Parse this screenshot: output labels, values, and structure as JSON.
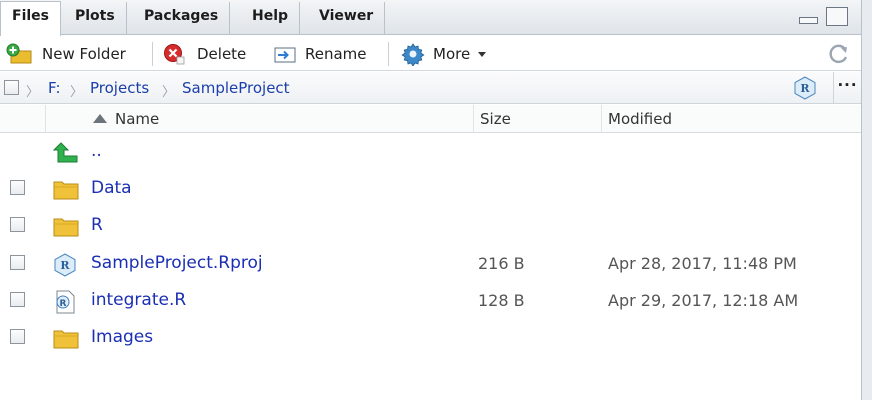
{
  "tabs": [
    {
      "label": "Files"
    },
    {
      "label": "Plots"
    },
    {
      "label": "Packages"
    },
    {
      "label": "Help"
    },
    {
      "label": "Viewer"
    }
  ],
  "toolbar": {
    "new_folder": "New Folder",
    "delete": "Delete",
    "rename": "Rename",
    "more": "More"
  },
  "breadcrumb": {
    "items": [
      "F:",
      "Projects",
      "SampleProject"
    ]
  },
  "table": {
    "columns": {
      "name": "Name",
      "size": "Size",
      "modified": "Modified"
    },
    "rows": [
      {
        "icon": "up-arrow-icon",
        "name": "..",
        "size": "",
        "modified": ""
      },
      {
        "icon": "folder-icon",
        "name": "Data",
        "size": "",
        "modified": ""
      },
      {
        "icon": "folder-icon",
        "name": "R",
        "size": "",
        "modified": ""
      },
      {
        "icon": "rproj-icon",
        "name": "SampleProject.Rproj",
        "size": "216 B",
        "modified": "Apr 28, 2017, 11:48 PM"
      },
      {
        "icon": "r-script-icon",
        "name": "integrate.R",
        "size": "128 B",
        "modified": "Apr 29, 2017, 12:18 AM"
      },
      {
        "icon": "folder-icon",
        "name": "Images",
        "size": "",
        "modified": ""
      }
    ]
  },
  "colors": {
    "link": "#1b2fb3",
    "folder": "#e8b923",
    "up_arrow": "#2aa650"
  }
}
